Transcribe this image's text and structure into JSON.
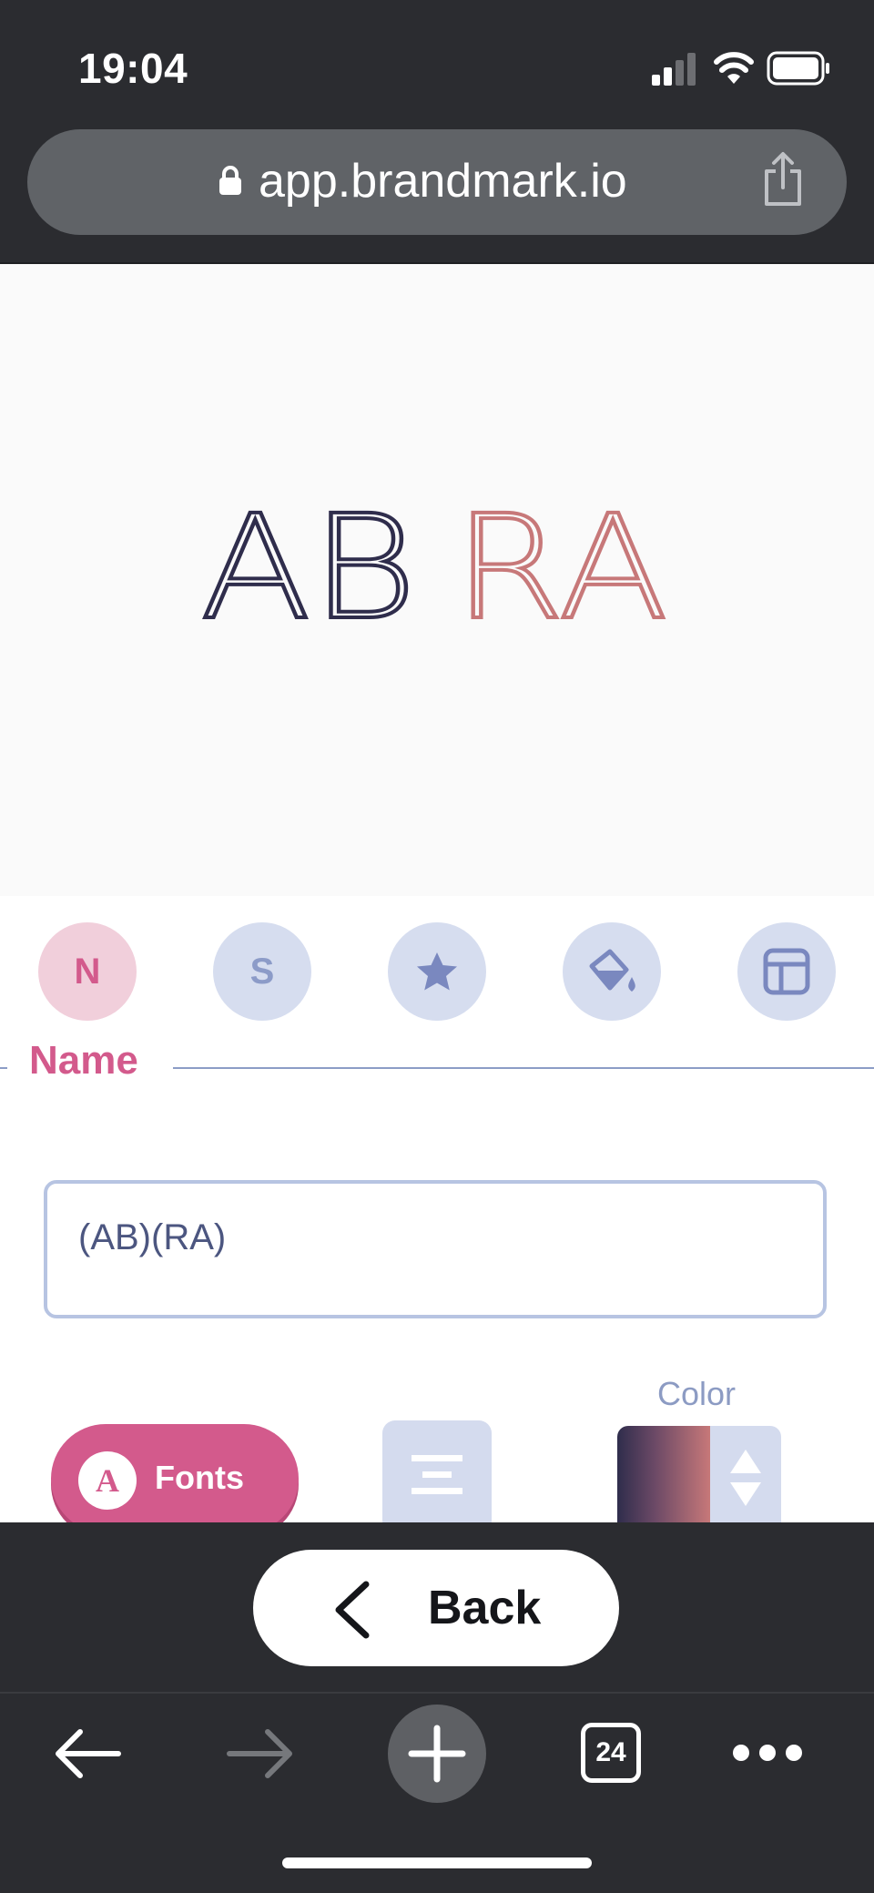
{
  "status_bar": {
    "time": "19:04",
    "icons": [
      "signal-icon",
      "wifi-icon",
      "battery-icon"
    ]
  },
  "browser": {
    "url": "app.brandmark.io",
    "tabs_count": "24"
  },
  "logo": {
    "left_part": "AB",
    "right_part": "RA",
    "left_color": "#2f2d4c",
    "right_color": "#c77879"
  },
  "editor": {
    "nav": [
      {
        "key": "name",
        "letter": "N",
        "active": true
      },
      {
        "key": "slogan",
        "letter": "S",
        "active": false
      },
      {
        "key": "icon",
        "icon": "star-icon",
        "active": false
      },
      {
        "key": "color",
        "icon": "paint-bucket-icon",
        "active": false
      },
      {
        "key": "layout",
        "icon": "layout-icon",
        "active": false
      }
    ],
    "section_title": "Name",
    "name_input_value": "(AB)(RA)",
    "color_label": "Color",
    "fonts_button_label": "Fonts",
    "fonts_icon_letter": "A"
  },
  "back_button_label": "Back",
  "colors": {
    "accent": "#d35a8c",
    "panel_blue": "#d4dbee",
    "dark": "#2b2c30"
  }
}
